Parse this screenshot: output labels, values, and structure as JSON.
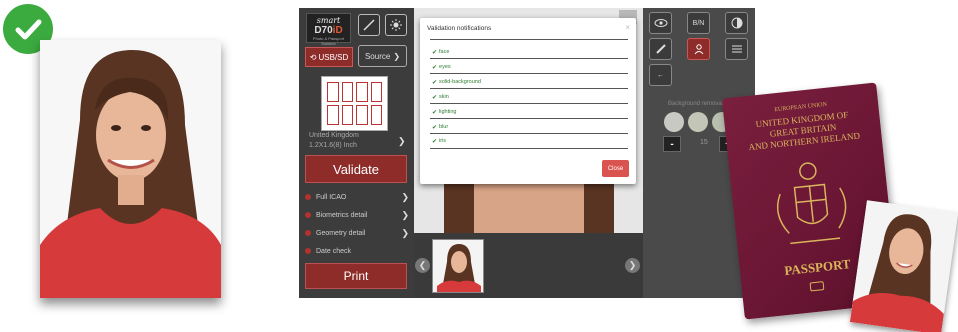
{
  "logo": {
    "line1": "smart",
    "line2a": "D70",
    "line2b": "iD",
    "line3": "Photo & Passport Solution"
  },
  "left_panel": {
    "usb_label": "USB/SD",
    "source_label": "Source",
    "country_line1": "United Kingdom",
    "country_line2": "1.2X1.6(8) Inch",
    "validate_label": "Validate",
    "menu": [
      {
        "label": "Full ICAO"
      },
      {
        "label": "Biometrics detail"
      },
      {
        "label": "Geometry detail"
      },
      {
        "label": "Date check"
      }
    ],
    "print_label": "Print"
  },
  "right_panel": {
    "bw_label": "B/N",
    "bg_removal_label": "Background removal",
    "value": "15",
    "minus": "-",
    "plus": "+",
    "swatch_colors": [
      "#c9c9c4",
      "#c3c5b6",
      "#b9bfae"
    ]
  },
  "modal": {
    "title": "Validation notifications",
    "close_x": "×",
    "items": [
      "face",
      "eyes",
      "solid-background",
      "skin",
      "lighting",
      "blur",
      "iris"
    ],
    "close_button": "Close"
  },
  "passport": {
    "line0": "EUROPEAN UNION",
    "line1": "UNITED KINGDOM OF",
    "line2": "GREAT BRITAIN",
    "line3": "AND NORTHERN IRELAND",
    "title": "PASSPORT"
  },
  "colors": {
    "accent_red": "#8e2c2a",
    "success_green": "#3bab3f",
    "passport": "#6a1634",
    "gold": "#d9b45b"
  }
}
